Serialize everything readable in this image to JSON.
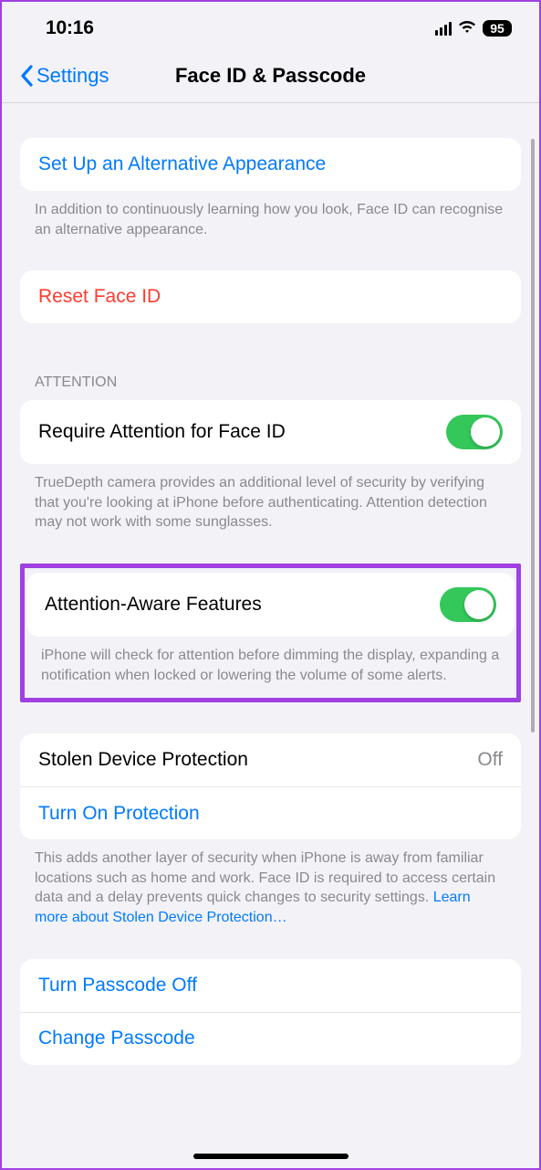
{
  "statusBar": {
    "time": "10:16",
    "battery": "95"
  },
  "nav": {
    "backLabel": "Settings",
    "title": "Face ID & Passcode"
  },
  "setupAlternative": {
    "label": "Set Up an Alternative Appearance",
    "footer": "In addition to continuously learning how you look, Face ID can recognise an alternative appearance."
  },
  "resetFaceId": {
    "label": "Reset Face ID"
  },
  "attention": {
    "header": "ATTENTION",
    "require": {
      "label": "Require Attention for Face ID",
      "footer": "TrueDepth camera provides an additional level of security by verifying that you're looking at iPhone before authenticating. Attention detection may not work with some sunglasses."
    },
    "aware": {
      "label": "Attention-Aware Features",
      "footer": "iPhone will check for attention before dimming the display, expanding a notification when locked or lowering the volume of some alerts."
    }
  },
  "stolen": {
    "label": "Stolen Device Protection",
    "value": "Off",
    "turnOn": "Turn On Protection",
    "footerA": "This adds another layer of security when iPhone is away from familiar locations such as home and work. Face ID is required to access certain data and a delay prevents quick changes to security settings. ",
    "footerLink": "Learn more about Stolen Device Protection…"
  },
  "passcode": {
    "turnOff": "Turn Passcode Off",
    "change": "Change Passcode"
  }
}
